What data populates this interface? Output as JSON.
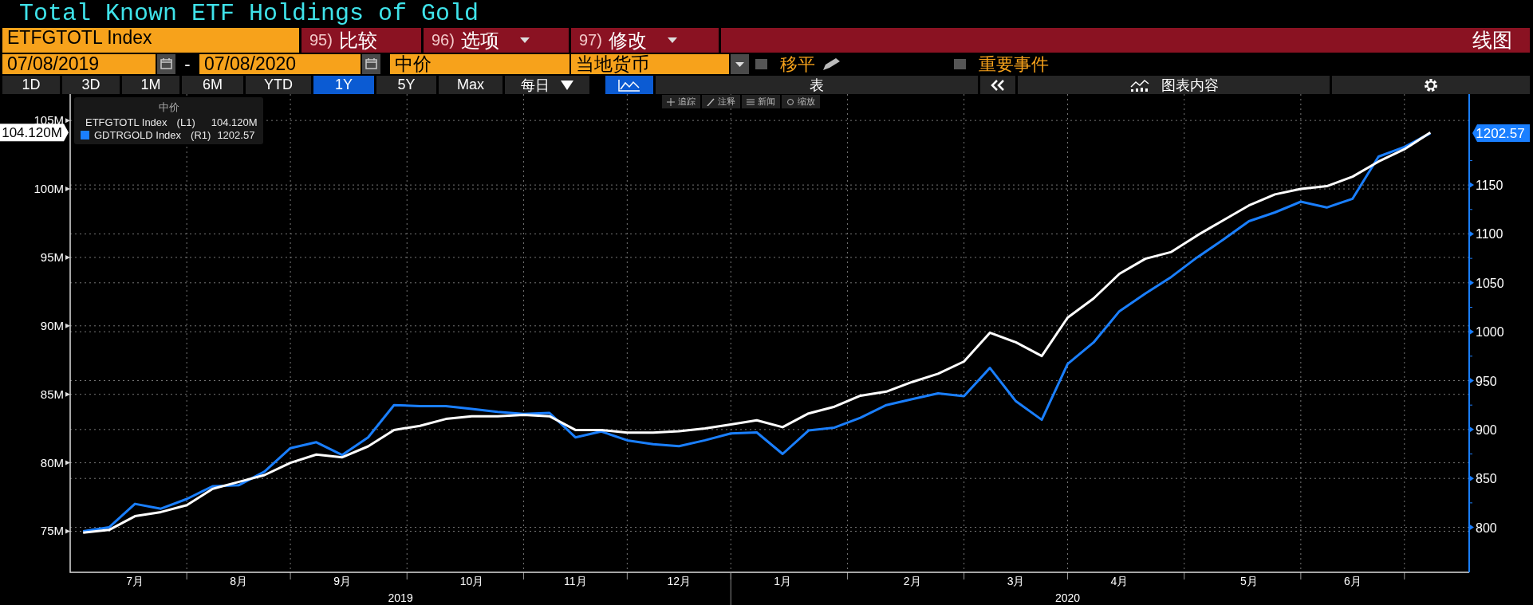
{
  "title": "Total Known ETF Holdings of Gold",
  "security_field": {
    "value": "ETFGTOTL Index"
  },
  "menu_buttons": [
    {
      "number": "95)",
      "label": "比较",
      "dropdown": false
    },
    {
      "number": "96)",
      "label": "选项",
      "dropdown": true
    },
    {
      "number": "97)",
      "label": "修改",
      "dropdown": true
    }
  ],
  "chart_type": "线图",
  "date_range": {
    "start": "07/08/2019",
    "separator": "-",
    "end": "07/08/2020"
  },
  "price_field": {
    "value": "中价"
  },
  "currency_field": {
    "value": "当地货币"
  },
  "options": [
    {
      "label": "移平",
      "checked": false
    },
    {
      "label": "重要事件",
      "checked": false
    }
  ],
  "periods": [
    {
      "label": "1D",
      "selected": false
    },
    {
      "label": "3D",
      "selected": false
    },
    {
      "label": "1M",
      "selected": false
    },
    {
      "label": "6M",
      "selected": false
    },
    {
      "label": "YTD",
      "selected": false
    },
    {
      "label": "1Y",
      "selected": true
    },
    {
      "label": "5Y",
      "selected": false
    },
    {
      "label": "Max",
      "selected": false
    }
  ],
  "frequency": {
    "value": "每日"
  },
  "view_buttons": [
    {
      "kind": "icon",
      "selected": true
    },
    {
      "kind": "text",
      "label": "表",
      "selected": false
    }
  ],
  "chart_contents_button": {
    "label": "图表内容"
  },
  "chart_tools": [
    {
      "kind": "track",
      "label": "追踪"
    },
    {
      "kind": "annotate",
      "label": "注释"
    },
    {
      "kind": "news",
      "label": "新闻"
    },
    {
      "kind": "zoom",
      "label": "缩放"
    }
  ],
  "legend": {
    "title": "中价",
    "items": [
      {
        "axis": "(L1)",
        "value": "104.120M"
      },
      {
        "axis": "(R1)",
        "value": "1202.57"
      }
    ]
  },
  "axis_tags": [
    {
      "text": "104.120M"
    },
    {
      "text": "1202.57"
    }
  ],
  "year_labels": [
    {
      "label": "2019"
    },
    {
      "label": "2020"
    }
  ],
  "chart_data": {
    "type": "line",
    "grid": true,
    "categories": [
      null,
      null,
      "7月",
      null,
      null,
      null,
      "8月",
      null,
      null,
      null,
      "9月",
      null,
      null,
      null,
      null,
      "10月",
      null,
      null,
      null,
      "11月",
      null,
      null,
      null,
      "12月",
      null,
      null,
      null,
      "1月",
      null,
      null,
      null,
      null,
      "2月",
      null,
      null,
      null,
      "3月",
      null,
      null,
      null,
      "4月",
      null,
      null,
      null,
      null,
      "5月",
      null,
      null,
      null,
      "6月",
      null,
      null,
      null
    ],
    "ylim": [
      72.0,
      106.93
    ],
    "yticks": [
      {
        "value": 75,
        "label": "75M"
      },
      {
        "value": 80,
        "label": "80M"
      },
      {
        "value": 85,
        "label": "85M"
      },
      {
        "value": 90,
        "label": "90M"
      },
      {
        "value": 95,
        "label": "95M"
      },
      {
        "value": 100,
        "label": "100M"
      },
      {
        "value": 105,
        "label": "105M"
      }
    ],
    "y2lim": [
      754,
      1243
    ],
    "y2ticks": [
      800,
      850,
      900,
      950,
      1000,
      1050,
      1100,
      1150
    ],
    "series": [
      {
        "name": "ETFGTOTL Index",
        "color": "#ffffff",
        "values": [
          74.9,
          75.1,
          76.1,
          76.4,
          76.9,
          78.1,
          78.6,
          79.1,
          80.0,
          80.6,
          80.4,
          81.2,
          82.4,
          82.7,
          83.2,
          83.4,
          83.4,
          83.5,
          83.4,
          82.4,
          82.4,
          82.2,
          82.2,
          82.3,
          82.5,
          82.8,
          83.1,
          82.6,
          83.6,
          84.1,
          84.9,
          85.2,
          85.9,
          86.5,
          87.4,
          89.5,
          88.8,
          87.8,
          90.6,
          92.0,
          93.8,
          94.9,
          95.4,
          96.6,
          97.7,
          98.8,
          99.6,
          100.0,
          100.2,
          100.9,
          102.0,
          102.9,
          104.12
        ]
      },
      {
        "name": "GDTRGOLD Index",
        "color": "#1a7fff",
        "axis": "y2",
        "values": [
          796,
          800,
          824,
          819,
          829,
          842,
          843,
          857,
          881,
          887,
          874,
          892,
          925,
          924,
          924,
          921,
          918,
          916,
          917,
          892,
          898,
          889,
          885,
          883,
          889,
          896,
          897,
          875,
          899,
          902,
          912,
          925,
          931,
          937,
          934,
          963,
          929,
          910,
          967,
          989,
          1021,
          1039,
          1056,
          1076,
          1094,
          1113,
          1122,
          1133,
          1127,
          1136,
          1179,
          1189,
          1203
        ]
      }
    ]
  }
}
